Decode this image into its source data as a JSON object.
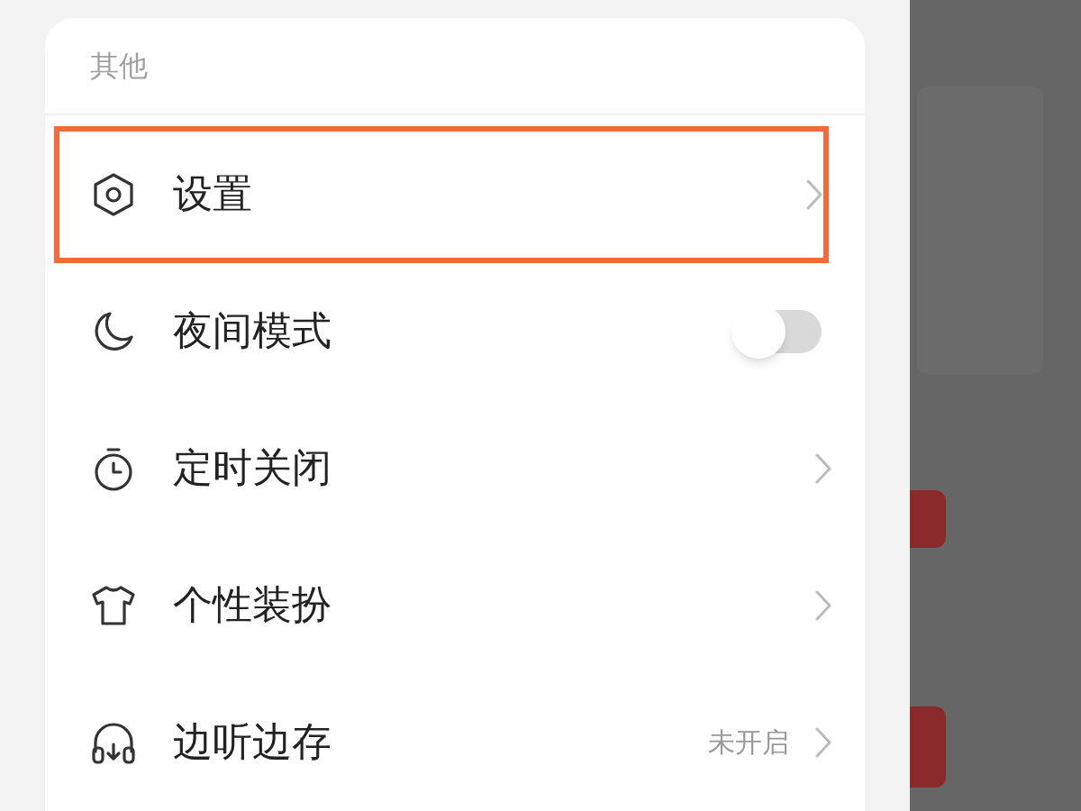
{
  "section": {
    "title": "其他"
  },
  "items": [
    {
      "kind": "chevron",
      "label": "设置",
      "highlighted": true
    },
    {
      "kind": "toggle",
      "label": "夜间模式",
      "on": false,
      "highlighted": false
    },
    {
      "kind": "chevron",
      "label": "定时关闭",
      "highlighted": false
    },
    {
      "kind": "chevron",
      "label": "个性装扮",
      "highlighted": false
    },
    {
      "kind": "chevron",
      "label": "边听边存",
      "value": "未开启",
      "highlighted": false
    }
  ]
}
